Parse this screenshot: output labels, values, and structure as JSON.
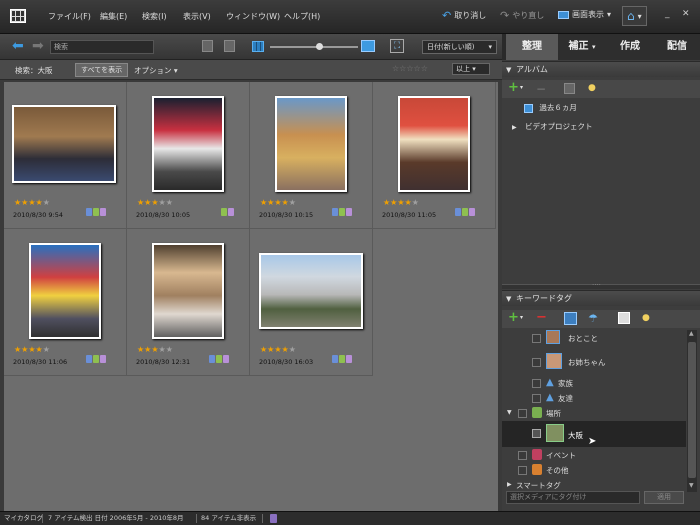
{
  "menubar": {
    "items": [
      "ファイル(F)",
      "編集(E)",
      "検索(I)",
      "表示(V)",
      "ウィンドウ(W)",
      "ヘルプ(H)"
    ],
    "undo": "取り消し",
    "redo": "やり直し",
    "display": "画面表示"
  },
  "toolbar": {
    "search_placeholder": "検索",
    "sort": "日付(新しい順)"
  },
  "tabs": [
    "整理",
    "補正",
    "作成",
    "配信"
  ],
  "filterbar": {
    "query": "検索：大阪",
    "show_all": "すべてを表示",
    "options": "オプション",
    "rating_filter": "以上"
  },
  "photos": [
    {
      "date": "2010/8/30 9:54",
      "rating": 4,
      "scene": "kids"
    },
    {
      "date": "2010/8/30 10:05",
      "rating": 3,
      "scene": "mascot"
    },
    {
      "date": "2010/8/30 10:15",
      "rating": 4,
      "scene": "statue"
    },
    {
      "date": "2010/8/30 11:05",
      "rating": 4,
      "scene": "crab"
    },
    {
      "date": "2010/8/30 11:06",
      "rating": 4,
      "scene": "glico"
    },
    {
      "date": "2010/8/30 12:31",
      "rating": 3,
      "scene": "bigface"
    },
    {
      "date": "2010/8/30 16:03",
      "rating": 4,
      "scene": "car"
    }
  ],
  "album": {
    "title": "アルバム",
    "items": [
      "過去６ヵ月",
      "ビデオプロジェクト"
    ]
  },
  "keywords": {
    "title": "キーワードタグ",
    "rows": [
      {
        "label": "おとこと",
        "kind": "person"
      },
      {
        "label": "お姉ちゃん",
        "kind": "person"
      },
      {
        "label": "家族",
        "kind": "group"
      },
      {
        "label": "友達",
        "kind": "group"
      },
      {
        "label": "場所",
        "kind": "category"
      },
      {
        "label": "大阪",
        "kind": "place"
      },
      {
        "label": "イベント",
        "kind": "category"
      },
      {
        "label": "その他",
        "kind": "category"
      },
      {
        "label": "スマートタグ",
        "kind": "category"
      }
    ],
    "tag_input_placeholder": "選択メディアにタグ付け",
    "apply": "適用"
  },
  "status": {
    "catalog": "マイカタログ",
    "summary": "7 アイテム検出 日付 2006年5月 - 2010年8月",
    "hidden": "84 アイテム非表示"
  },
  "colors": {
    "accent": "#2a8fd8",
    "star": "#f0a000"
  }
}
